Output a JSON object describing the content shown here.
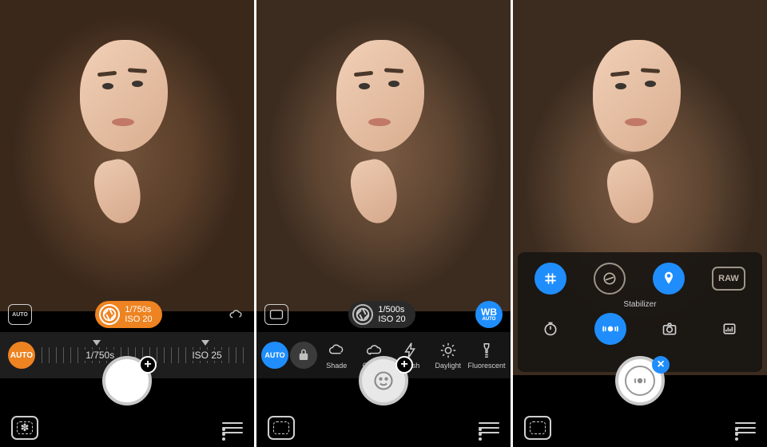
{
  "panel1": {
    "auto_box": "AUTO",
    "pill": {
      "line1": "1/750s",
      "line2": "ISO 20"
    },
    "cloud_icon": "cloud-icon",
    "auto_btn": "AUTO",
    "scale": {
      "shutter": "1/750s",
      "iso": "ISO 25"
    },
    "shutter_badge": "+"
  },
  "panel2": {
    "pill": {
      "line1": "1/500s",
      "line2": "ISO 20"
    },
    "wb_btn": {
      "line1": "WB",
      "line2": "AUTO"
    },
    "auto_btn": "AUTO",
    "options": [
      {
        "id": "shade",
        "label": "Shade"
      },
      {
        "id": "cloudy",
        "label": "Cloudy"
      },
      {
        "id": "flash",
        "label": "Flash"
      },
      {
        "id": "daylight",
        "label": "Daylight"
      },
      {
        "id": "fluorescent",
        "label": "Fluorescent"
      }
    ],
    "shutter_badge": "+"
  },
  "panel3": {
    "overlay": {
      "raw": "RAW",
      "stabilizer_label": "Stabilizer"
    },
    "shutter_badge": "×"
  },
  "colors": {
    "accent_orange": "#ee8321",
    "accent_blue": "#1f8efc"
  }
}
